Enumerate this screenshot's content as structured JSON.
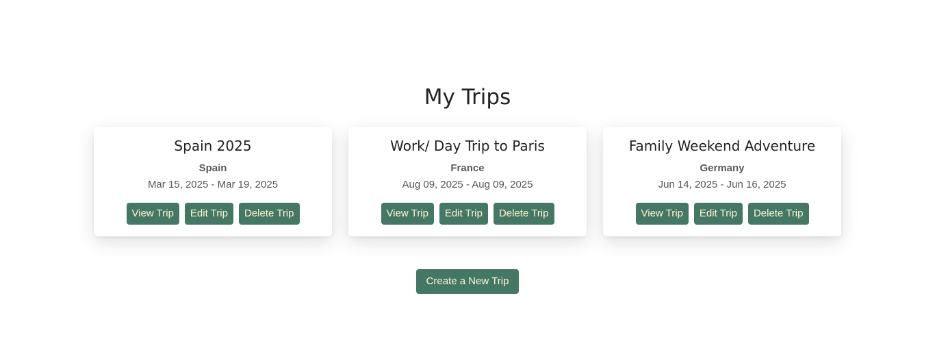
{
  "page_title": "My Trips",
  "trips": [
    {
      "title": "Spain 2025",
      "country": "Spain",
      "dates": "Mar 15, 2025 - Mar 19, 2025",
      "view_label": "View Trip",
      "edit_label": "Edit Trip",
      "delete_label": "Delete Trip"
    },
    {
      "title": "Work/ Day Trip to Paris",
      "country": "France",
      "dates": "Aug 09, 2025 - Aug 09, 2025",
      "view_label": "View Trip",
      "edit_label": "Edit Trip",
      "delete_label": "Delete Trip"
    },
    {
      "title": "Family Weekend Adventure",
      "country": "Germany",
      "dates": "Jun 14, 2025 - Jun 16, 2025",
      "view_label": "View Trip",
      "edit_label": "Edit Trip",
      "delete_label": "Delete Trip"
    }
  ],
  "create_label": "Create a New Trip",
  "colors": {
    "button_bg": "#457864",
    "button_text": "#fdf7d6",
    "page_bg": "#ffffff"
  }
}
